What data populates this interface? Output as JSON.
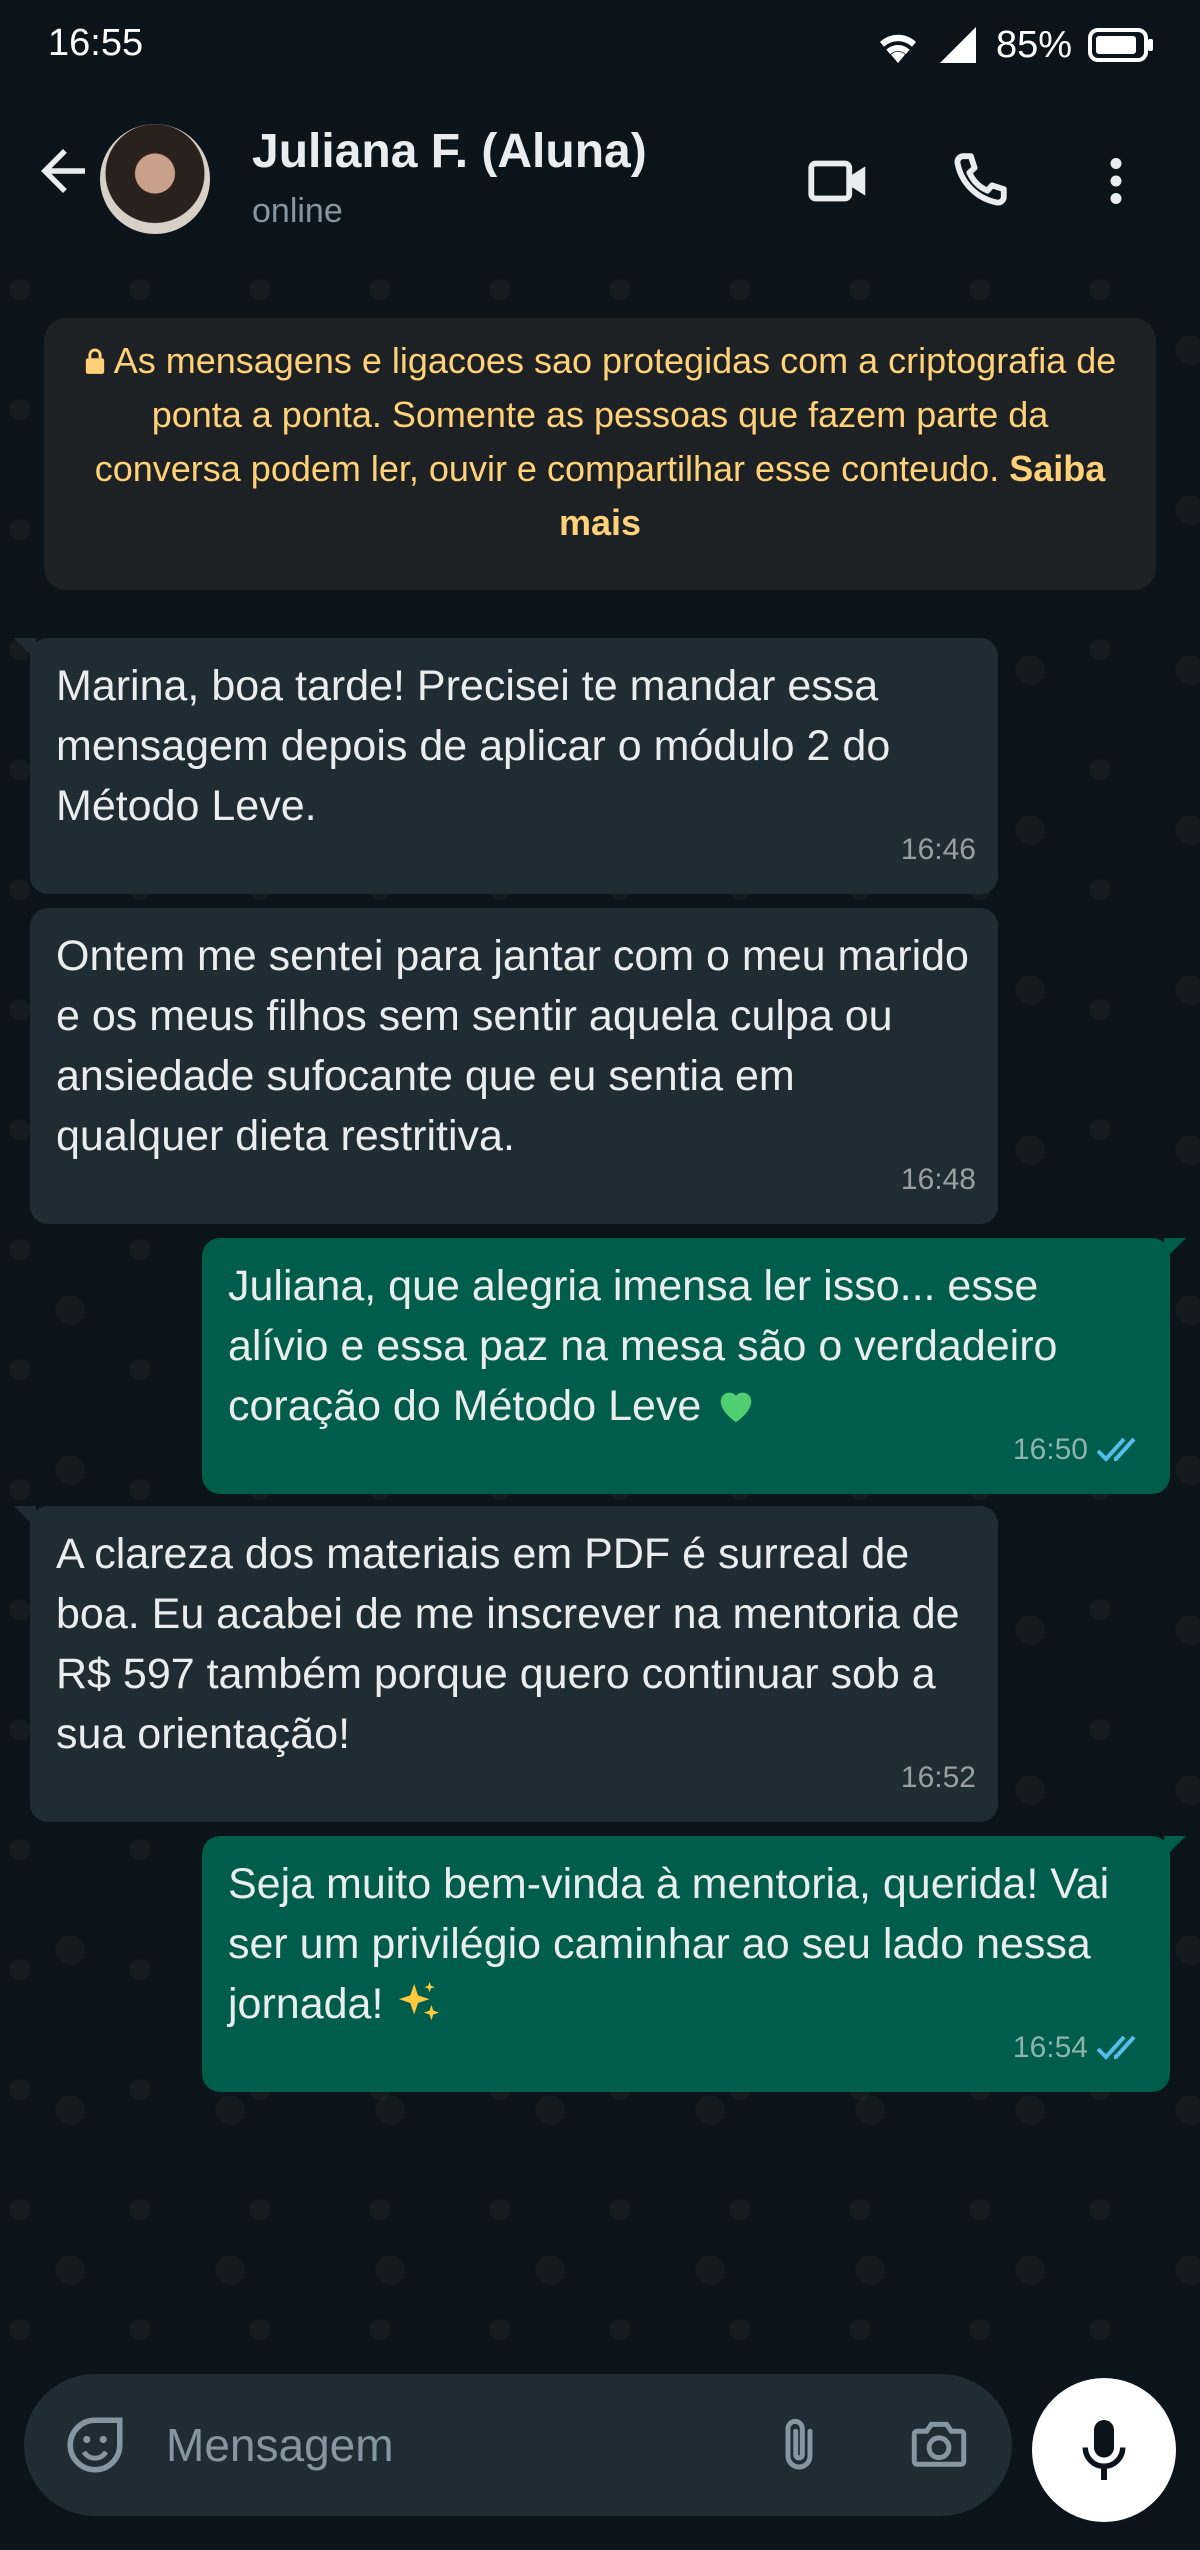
{
  "status_bar": {
    "time": "16:55",
    "battery_percent": "85%",
    "icons": [
      "wifi-icon",
      "signal-icon",
      "battery-icon"
    ]
  },
  "header": {
    "contact_name": "Juliana F. (Aluna)",
    "contact_status": "online",
    "icons": [
      "back-arrow-icon",
      "video-call-icon",
      "phone-icon",
      "more-options-icon"
    ]
  },
  "encryption_notice": {
    "text": "As mensagens e ligacoes sao protegidas com a criptografia de ponta a ponta. Somente as pessoas que fazem parte da conversa podem ler, ouvir e compartilhar esse conteudo.",
    "link_label": "Saiba mais",
    "icon": "lock-icon"
  },
  "messages": [
    {
      "direction": "incoming",
      "text": "Marina, boa tarde! Precisei te mandar essa mensagem depois de aplicar o módulo 2 do Método Leve.",
      "time": "16:46"
    },
    {
      "direction": "incoming",
      "text": "Ontem me sentei para jantar com o meu marido e os meus filhos sem sentir aquela culpa ou ansiedade sufocante que eu sentia em qualquer dieta restritiva.",
      "time": "16:48"
    },
    {
      "direction": "outgoing",
      "text": "Juliana, que alegria imensa ler isso... esse alívio e essa paz na mesa são o verdadeiro coração do Método Leve",
      "emoji": "green-heart-icon",
      "time": "16:50",
      "status": "read"
    },
    {
      "direction": "incoming",
      "text": "A clareza dos materiais em PDF é surreal de boa. Eu acabei de me inscrever na mentoria de R$ 597 também porque quero continuar sob a sua orientação!",
      "time": "16:52"
    },
    {
      "direction": "outgoing",
      "text": "Seja muito bem-vinda à mentoria, querida! Vai ser um privilégio caminhar ao seu lado nessa jornada!",
      "emoji": "sparkles-icon",
      "time": "16:54",
      "status": "read"
    }
  ],
  "input_bar": {
    "placeholder": "Mensagem",
    "value": "",
    "icons": [
      "sticker-icon",
      "attach-icon",
      "camera-icon",
      "mic-icon"
    ]
  },
  "colors": {
    "background": "#0b141a",
    "incoming_bubble": "#202c33",
    "outgoing_bubble": "#005c4b",
    "notice_text": "#ffd279",
    "read_ticks": "#53bdeb"
  }
}
